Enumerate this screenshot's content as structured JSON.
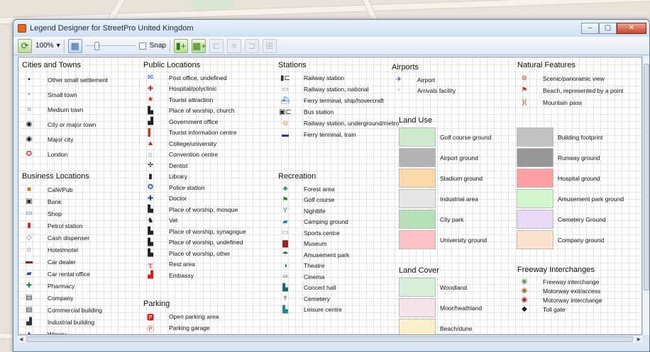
{
  "window": {
    "title": "Legend Designer for StreetPro United Kingdom",
    "buttons": [
      "–",
      "▢",
      "✕"
    ]
  },
  "toolbar": {
    "zoom": "100%",
    "snap_label": "Snap"
  },
  "sections": {
    "cities": {
      "title": "Cities and Towns",
      "items": [
        {
          "icon": "•",
          "label": "Other small settlement"
        },
        {
          "icon": "◦",
          "label": "Small town"
        },
        {
          "icon": "○",
          "label": "Medium town"
        },
        {
          "icon": "◉",
          "label": "City or major town"
        },
        {
          "icon": "◉",
          "label": "Major city"
        },
        {
          "icon": "✪",
          "label": "London",
          "color": "#c0392b"
        }
      ]
    },
    "business": {
      "title": "Business Locations",
      "items": [
        {
          "icon": "■",
          "label": "Café/Pub",
          "color": "#c6761b"
        },
        {
          "icon": "▣",
          "label": "Bank",
          "color": "#333"
        },
        {
          "icon": "▭",
          "label": "Shop",
          "color": "#1f6fb5"
        },
        {
          "icon": "▮",
          "label": "Petrol station",
          "color": "#d0201b"
        },
        {
          "icon": "◇",
          "label": "Cash dispenser",
          "color": "#666"
        },
        {
          "icon": "⌂",
          "label": "Hotel/motel",
          "color": "#d0201b"
        },
        {
          "icon": "▬",
          "label": "Car dealer",
          "color": "#a31c1c"
        },
        {
          "icon": "▰",
          "label": "Car rental office",
          "color": "#2a3f9a"
        },
        {
          "icon": "✚",
          "label": "Pharmacy",
          "color": "#1a8b28"
        },
        {
          "icon": "▤",
          "label": "Company",
          "color": "#333"
        },
        {
          "icon": "▤",
          "label": "Commercial building",
          "color": "#333"
        },
        {
          "icon": "▟",
          "label": "Industrial building",
          "color": "#333"
        },
        {
          "icon": "▲",
          "label": "Winery",
          "color": "#6a2b8c"
        }
      ]
    },
    "public": {
      "title": "Public Locations",
      "items": [
        {
          "icon": "✉",
          "label": "Post office, undefined",
          "color": "#2a56b5"
        },
        {
          "icon": "✚",
          "label": "Hospital/polyclinic",
          "color": "#d0201b"
        },
        {
          "icon": "★",
          "label": "Tourist attraction",
          "color": "#d0201b"
        },
        {
          "icon": "▙",
          "label": "Place of worship, church",
          "color": "#222"
        },
        {
          "icon": "▟",
          "label": "Government office",
          "color": "#222"
        },
        {
          "icon": "▌",
          "label": "Tourist information centre",
          "color": "#c0392b"
        },
        {
          "icon": "▲",
          "label": "College/university",
          "color": "#d0201b"
        },
        {
          "icon": "⌂",
          "label": "Convention centre",
          "color": "#1a8a6a"
        },
        {
          "icon": "✛",
          "label": "Dentist",
          "color": "#222"
        },
        {
          "icon": "▮",
          "label": "Library",
          "color": "#222"
        },
        {
          "icon": "✪",
          "label": "Police station",
          "color": "#2a56b5"
        },
        {
          "icon": "✚",
          "label": "Doctor",
          "color": "#1f3f9f"
        },
        {
          "icon": "▙",
          "label": "Place of worship, mosque",
          "color": "#222"
        },
        {
          "icon": "♞",
          "label": "Vet",
          "color": "#222"
        },
        {
          "icon": "▙",
          "label": "Place of worship, synagogue",
          "color": "#222"
        },
        {
          "icon": "▙",
          "label": "Place of worship, undefined",
          "color": "#222"
        },
        {
          "icon": "▙",
          "label": "Place of worship, other",
          "color": "#222"
        },
        {
          "icon": "╥",
          "label": "Rest area",
          "color": "#d0201b"
        },
        {
          "icon": "▟",
          "label": "Embassy",
          "color": "#d0201b"
        }
      ]
    },
    "parking": {
      "title": "Parking",
      "items": [
        {
          "icon": "🅿",
          "label": "Open parking area",
          "color": "#d0201b"
        },
        {
          "icon": "Ⓟ",
          "label": "Parking garage",
          "color": "#d0201b"
        }
      ]
    },
    "stations": {
      "title": "Stations",
      "items": [
        {
          "icon": "▮⊏",
          "label": "Railway station",
          "color": "#333"
        },
        {
          "icon": "▭",
          "label": "Railway station, national",
          "color": "#888"
        },
        {
          "icon": "⛴",
          "label": "Ferry terminal, ship/hovercraft",
          "color": "#1f6fb5"
        },
        {
          "icon": "▣⊏",
          "label": "Bus station",
          "color": "#333"
        },
        {
          "icon": "⊖",
          "label": "Railway station, underground/metro",
          "color": "#e67e22"
        },
        {
          "icon": "▬",
          "label": "Ferry terminal, train",
          "color": "#1f3f9f"
        }
      ]
    },
    "recreation": {
      "title": "Recreation",
      "items": [
        {
          "icon": "♣",
          "label": "Forest area",
          "color": "#1a8a6a"
        },
        {
          "icon": "⚑",
          "label": "Golf course",
          "color": "#1a8b28"
        },
        {
          "icon": "Y",
          "label": "Nightlife",
          "color": "#1a8a9a"
        },
        {
          "icon": "▰",
          "label": "Camping ground",
          "color": "#1a8a9a"
        },
        {
          "icon": "▭",
          "label": "Sports centre",
          "color": "#888"
        },
        {
          "icon": "▇",
          "label": "Museum",
          "color": "#a31c1c"
        },
        {
          "icon": "☂",
          "label": "Amusement park",
          "color": "#1a6a6a"
        },
        {
          "icon": "◑",
          "label": "Theatre",
          "color": "#1a6a6a"
        },
        {
          "icon": "∞",
          "label": "Cinema",
          "color": "#1a8a9a"
        },
        {
          "icon": "▙",
          "label": "Concert hall",
          "color": "#1a6a6a"
        },
        {
          "icon": "✝",
          "label": "Cemetery",
          "color": "#888"
        },
        {
          "icon": "▙",
          "label": "Leisure centre",
          "color": "#1a8a9a"
        }
      ]
    },
    "airports": {
      "title": "Airports",
      "items": [
        {
          "icon": "✈",
          "label": "Airport",
          "color": "#2a56b5"
        },
        {
          "icon": "▫",
          "label": "Arrivals facility",
          "color": "#888"
        }
      ]
    },
    "natural": {
      "title": "Natural Features",
      "items": [
        {
          "icon": "⊛",
          "label": "Scenic/panoramic view",
          "color": "#c0392b"
        },
        {
          "icon": "⚑",
          "label": "Beach, represented by a point",
          "color": "#c0392b"
        },
        {
          "icon": ")(",
          "label": "Mountain pass",
          "color": "#c0392b"
        }
      ]
    },
    "landuse": {
      "title": "Land Use",
      "items": [
        {
          "color": "#cfe9cc",
          "label": "Golf course ground"
        },
        {
          "color": "#b3b3b3",
          "label": "Airport ground"
        },
        {
          "color": "#fcd9a8",
          "label": "Stadium ground"
        },
        {
          "color": "#e6e6e6",
          "label": "Industrial area"
        },
        {
          "color": "#b5e0b8",
          "label": "City park"
        },
        {
          "color": "#ffc1c5",
          "label": "University ground"
        },
        {
          "color": "#c2c2c2",
          "label": "Building footprint"
        },
        {
          "color": "#969696",
          "label": "Runway ground"
        },
        {
          "color": "#ff9fa4",
          "label": "Hospital ground"
        },
        {
          "color": "#d3f5d0",
          "label": "Amusement park ground"
        },
        {
          "color": "#ead8f7",
          "label": "Cemetery Ground"
        },
        {
          "color": "#fde3cf",
          "label": "Company ground"
        }
      ]
    },
    "landcover": {
      "title": "Land Cover",
      "items": [
        {
          "color": "#d9efd9",
          "label": "Woodland"
        },
        {
          "color": "#f4e4ea",
          "label": "Moor/heathland"
        },
        {
          "color": "#fdf0c8",
          "label": "Beach/dune"
        }
      ]
    },
    "freeway": {
      "title": "Freeway Interchanges",
      "items": [
        {
          "icon": "◉",
          "label": "Freeway interchange",
          "color": "#6a8a6a"
        },
        {
          "icon": "◉",
          "label": "Motorway exit/access",
          "color": "#a36a1a"
        },
        {
          "icon": "◉",
          "label": "Motorway interchange",
          "color": "#a31c1c"
        },
        {
          "icon": "◆",
          "label": "Toll gate",
          "color": "#111"
        }
      ]
    }
  }
}
